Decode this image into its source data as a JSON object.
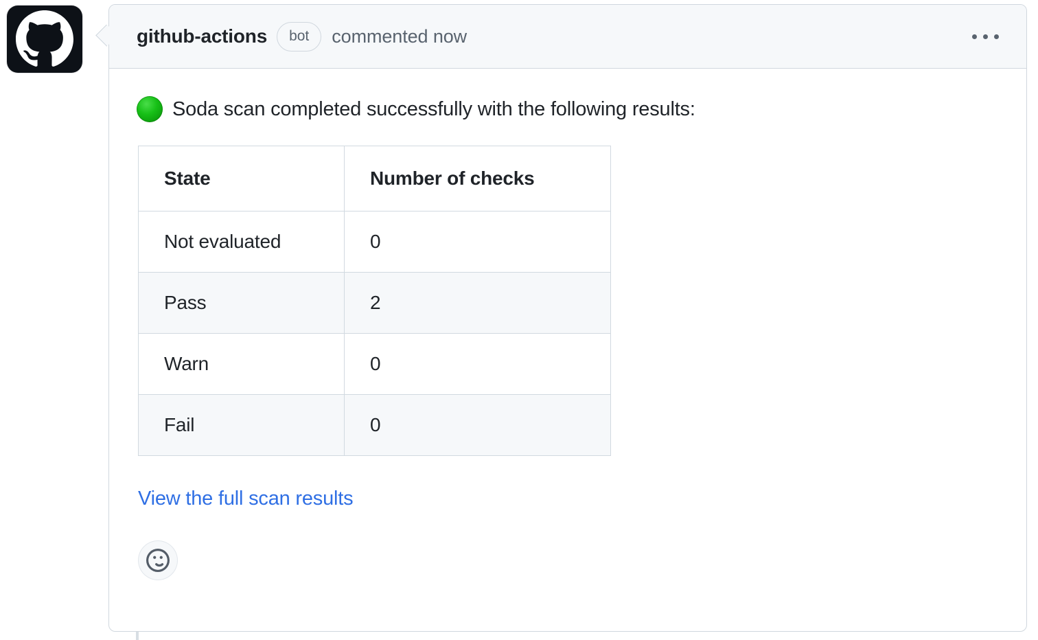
{
  "avatar": {
    "icon": "github-octocat-logo",
    "alt": "github-actions avatar"
  },
  "header": {
    "author": "github-actions",
    "badge": "bot",
    "action_text": "commented now",
    "menu_icon": "kebab-horizontal-icon"
  },
  "body": {
    "status_icon": "green-circle-icon",
    "intro_text": "Soda scan completed successfully with the following results:",
    "link_text": "View the full scan results",
    "reaction_icon": "smiley-icon"
  },
  "table": {
    "columns": [
      "State",
      "Number of checks"
    ],
    "rows": [
      {
        "state": "Not evaluated",
        "count": "0"
      },
      {
        "state": "Pass",
        "count": "2"
      },
      {
        "state": "Warn",
        "count": "0"
      },
      {
        "state": "Fail",
        "count": "0"
      }
    ]
  },
  "colors": {
    "link": "#2f6fe4",
    "status_green": "#17c017",
    "border": "#d0d7de",
    "header_bg": "#f6f8fa",
    "text": "#1f2328",
    "muted_text": "#59636e"
  }
}
